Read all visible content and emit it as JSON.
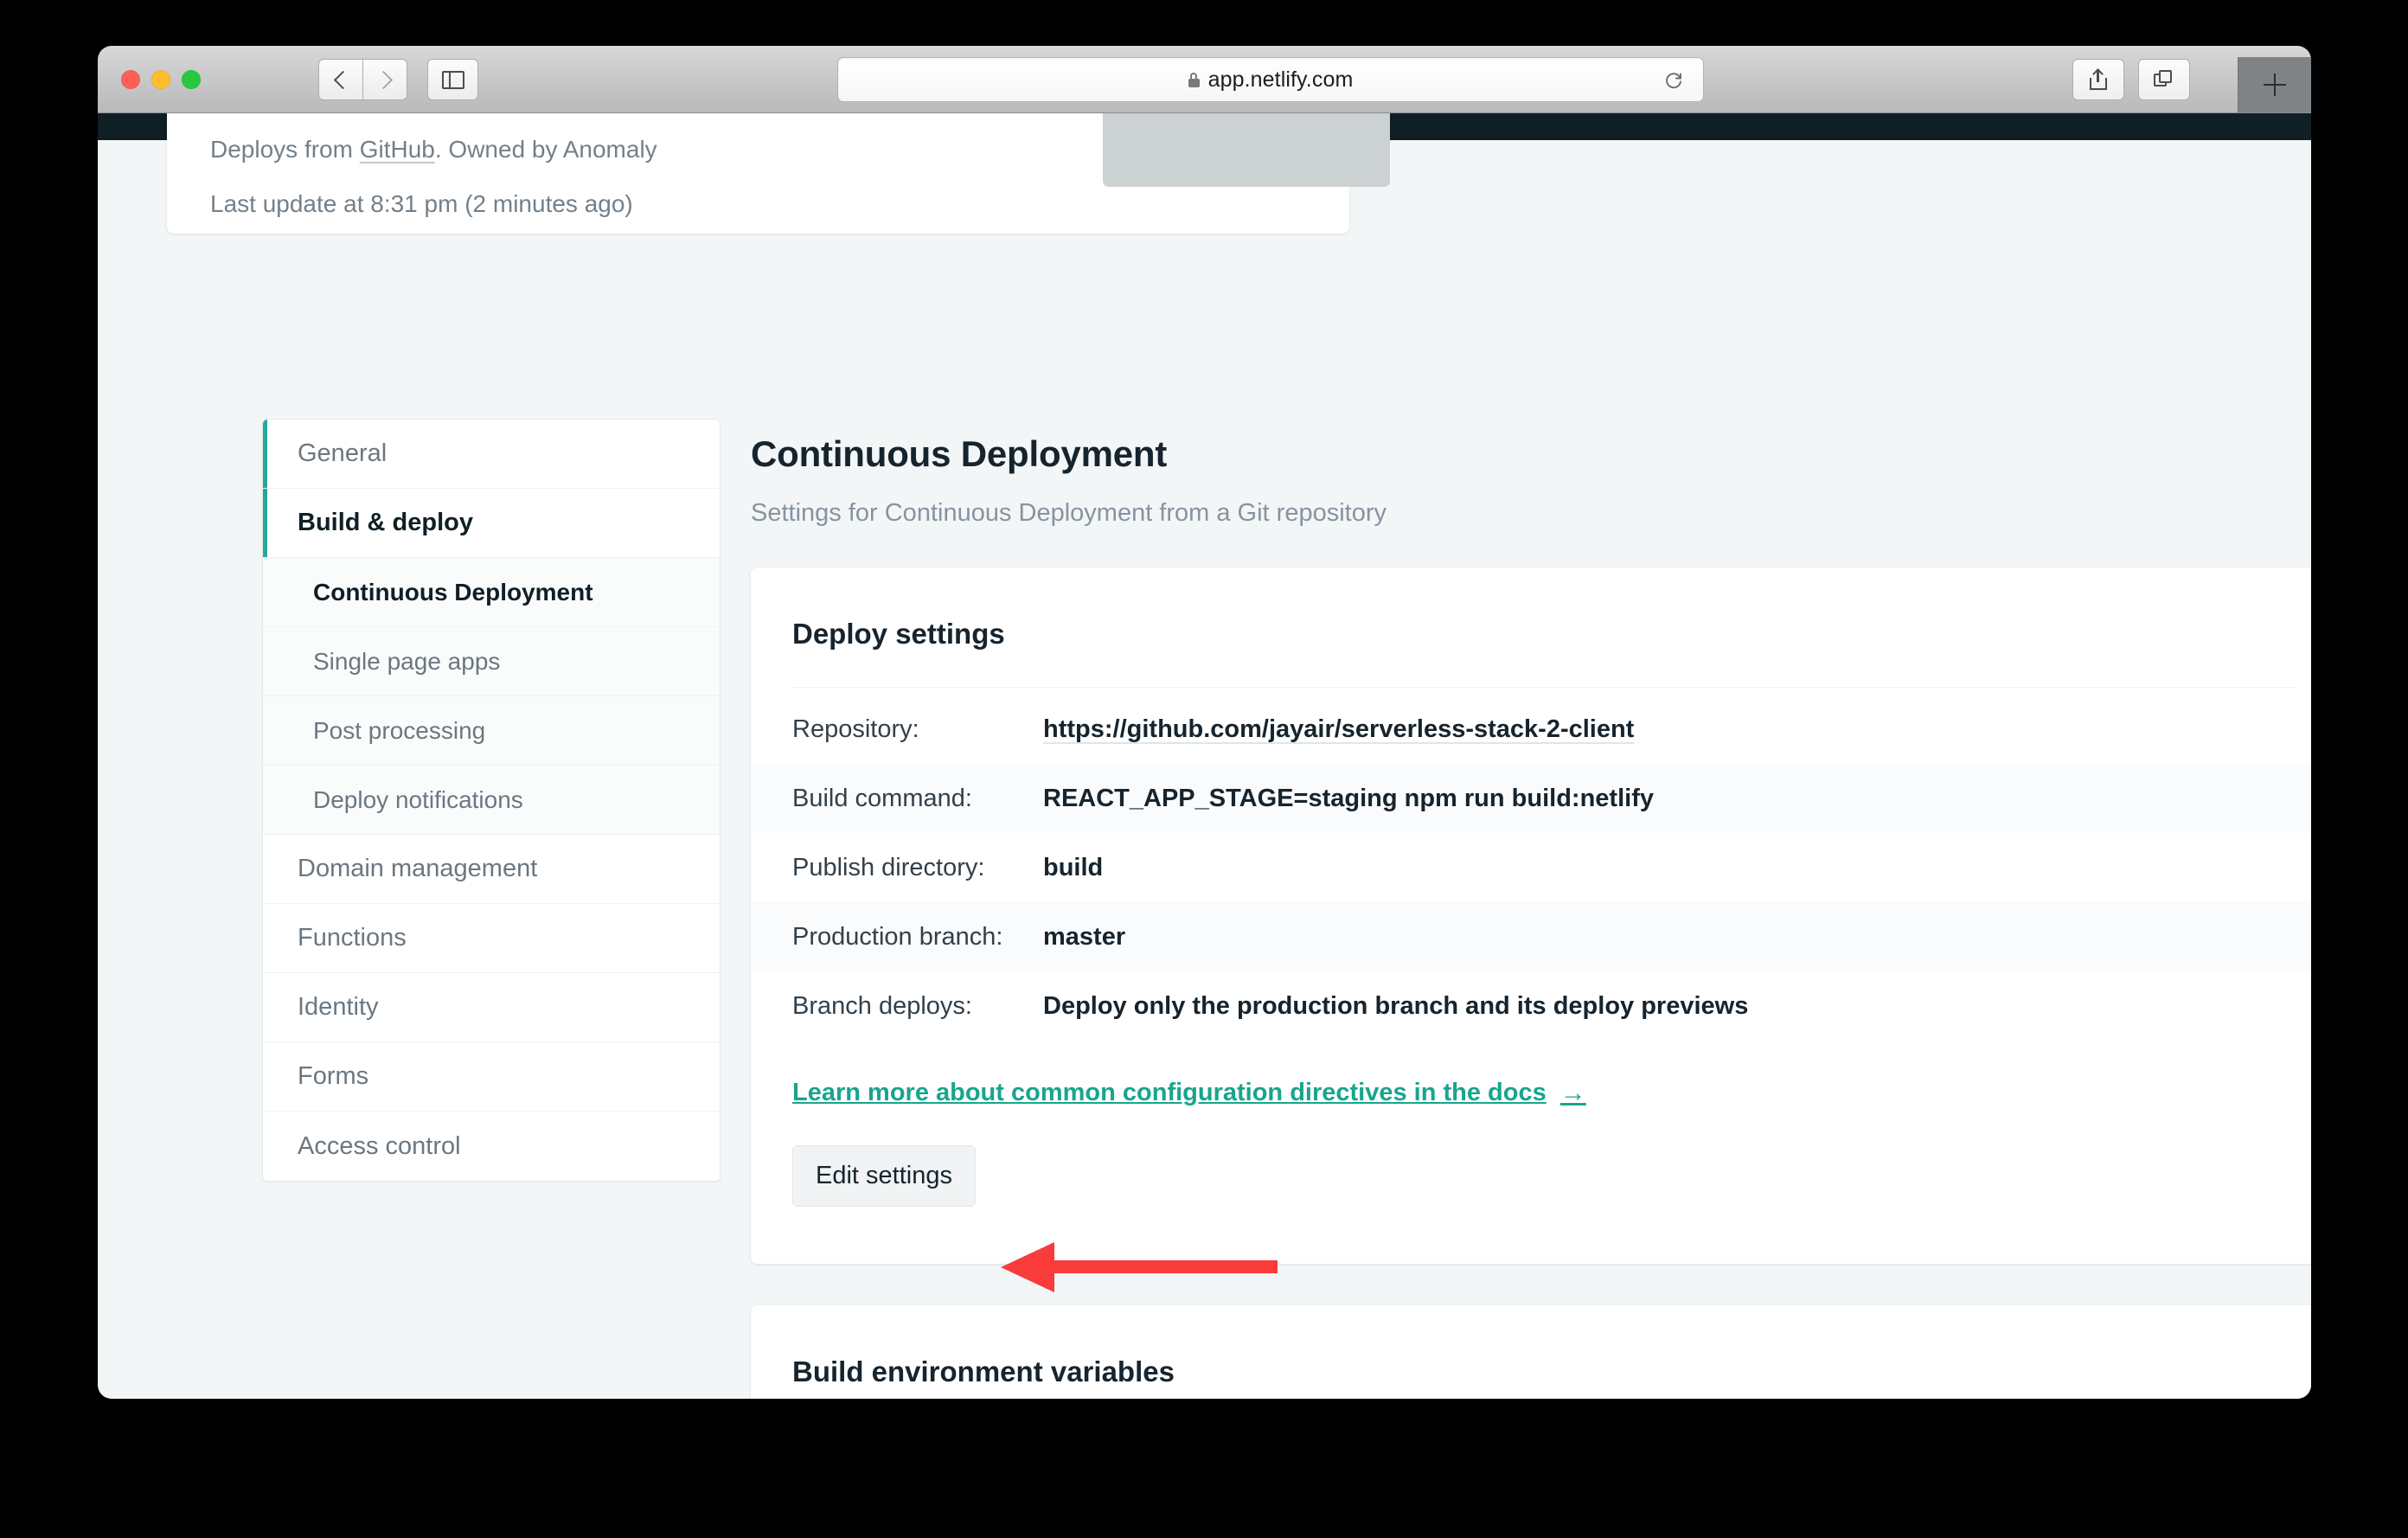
{
  "browser": {
    "url": "app.netlify.com",
    "lock_icon": "lock-icon",
    "back_icon": "chevron-left-icon",
    "forward_icon": "chevron-right-icon",
    "sidebar_icon": "sidebar-toggle-icon",
    "reload_icon": "reload-icon",
    "share_icon": "share-icon",
    "tabs_icon": "tab-overview-icon",
    "new_tab_icon": "plus-icon"
  },
  "site_card": {
    "deploys_prefix": "Deploys from ",
    "deploys_link": "GitHub",
    "deploys_suffix": ". Owned by Anomaly",
    "last_update": "Last update at 8:31 pm (2 minutes ago)"
  },
  "sidebar": {
    "items": [
      {
        "label": "General",
        "active": false,
        "sub": false
      },
      {
        "label": "Build & deploy",
        "active": true,
        "sub": false
      },
      {
        "label": "Continuous Deployment",
        "active": false,
        "sub": true,
        "current": true
      },
      {
        "label": "Single page apps",
        "active": false,
        "sub": true
      },
      {
        "label": "Post processing",
        "active": false,
        "sub": true
      },
      {
        "label": "Deploy notifications",
        "active": false,
        "sub": true
      },
      {
        "label": "Domain management",
        "active": false,
        "sub": false
      },
      {
        "label": "Functions",
        "active": false,
        "sub": false
      },
      {
        "label": "Identity",
        "active": false,
        "sub": false
      },
      {
        "label": "Forms",
        "active": false,
        "sub": false
      },
      {
        "label": "Access control",
        "active": false,
        "sub": false
      }
    ]
  },
  "main": {
    "title": "Continuous Deployment",
    "subtitle": "Settings for Continuous Deployment from a Git repository",
    "deploy_settings": {
      "heading": "Deploy settings",
      "rows": [
        {
          "key": "Repository:",
          "value": "https://github.com/jayair/serverless-stack-2-client",
          "link": true
        },
        {
          "key": "Build command:",
          "value": "REACT_APP_STAGE=staging npm run build:netlify",
          "link": false
        },
        {
          "key": "Publish directory:",
          "value": "build",
          "link": false
        },
        {
          "key": "Production branch:",
          "value": "master",
          "link": false
        },
        {
          "key": "Branch deploys:",
          "value": "Deploy only the production branch and its deploy previews",
          "link": false
        }
      ],
      "docs_link": "Learn more about common configuration directives in the docs",
      "docs_arrow": "→",
      "edit_button": "Edit settings"
    },
    "build_env": {
      "heading": "Build environment variables"
    }
  },
  "annotation": {
    "name": "red-arrow-pointing-to-edit-settings",
    "color": "#f93b3b",
    "direction": "left"
  },
  "colors": {
    "accent_teal": "#27a69a",
    "link_teal": "#18a58d",
    "page_bg": "#f3f6f7",
    "nav_dark": "#101f26",
    "annotation_red": "#f93b3b"
  }
}
